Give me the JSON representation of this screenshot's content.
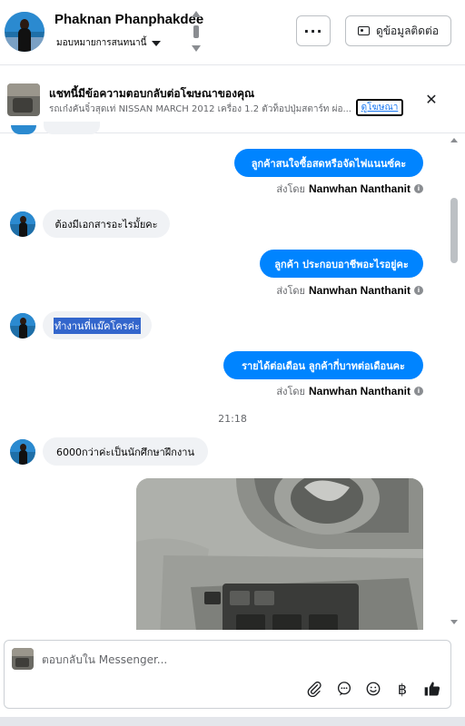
{
  "header": {
    "contact_name": "Phaknan Phanphakdee",
    "assign_label": "มอบหมายการสนทนานี้",
    "more_label": "···",
    "contact_info_label": "ดูข้อมูลติดต่อ",
    "icons": [
      "avatar",
      "up-down-arrows",
      "more-icon",
      "contact-card-icon",
      "chevron-down-icon"
    ]
  },
  "ad_banner": {
    "title": "แชทนี้มีข้อความตอบกลับต่อโฆษณาของคุณ",
    "subtitle": "รถเก๋งคันจิ๋วสุดเท่ NISSAN MARCH 2012 เครื่อง 1.2 ตัวท็อปปุ่มสตาร์ท ผ่อ...",
    "view_ad_label": "ดูโฆษณา",
    "close_label": "✕"
  },
  "messages": [
    {
      "direction": "out",
      "text": "ลูกค้าสนใจซื้อสดหรือจัดไฟแนนซ์คะ",
      "sent_by_prefix": "ส่งโดย",
      "sent_by_name": "Nanwhan Nanthanit"
    },
    {
      "direction": "in",
      "text": "ต้องมีเอกสารอะไรมั้ยคะ"
    },
    {
      "direction": "out",
      "text": "ลูกค้า ประกอบอาชีพอะไรอยู่คะ",
      "sent_by_prefix": "ส่งโดย",
      "sent_by_name": "Nanwhan Nanthanit"
    },
    {
      "direction": "in",
      "text": "ทำงานที่แม๊คโครค่ะ",
      "selected": true
    },
    {
      "direction": "out",
      "text": "รายได้ต่อเดือน  ลูกค้ากี่บาทต่อเดือนคะ",
      "sent_by_prefix": "ส่งโดย",
      "sent_by_name": "Nanwhan Nanthanit"
    },
    {
      "direction": "in",
      "text": "6000กว่าค่ะเป็นนักศึกษาฝึกงาน"
    }
  ],
  "timestamp": "21:18",
  "photo": {
    "description_icon": "car-door-interior-photo"
  },
  "composer": {
    "placeholder": "ตอบกลับใน Messenger...",
    "tools": [
      "attach-icon",
      "saved-reply-icon",
      "emoji-icon",
      "baht-payment-icon",
      "like-icon"
    ]
  },
  "colors": {
    "accent": "#0084ff",
    "incoming_bubble": "#f0f2f5",
    "selection": "#3366cc"
  }
}
